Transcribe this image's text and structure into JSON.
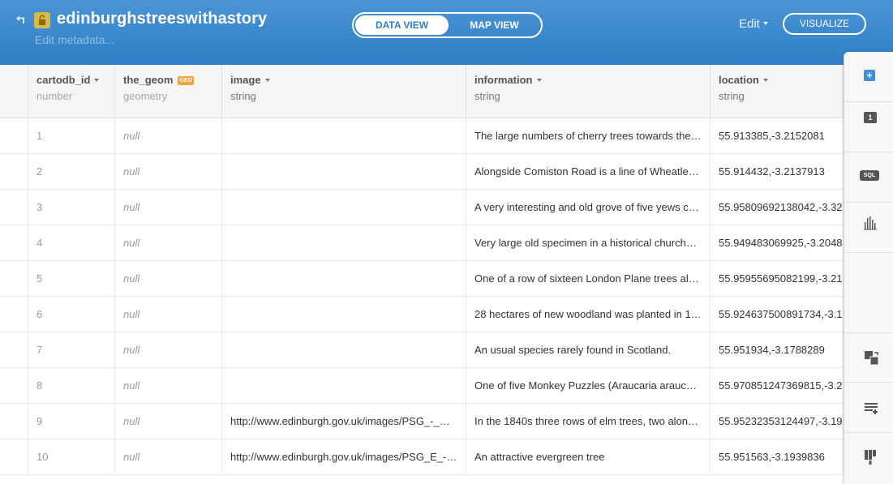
{
  "header": {
    "title": "edinburghstreeswithastory",
    "subtitle": "Edit metadata...",
    "view_toggle": {
      "data_view": "DATA VIEW",
      "map_view": "MAP VIEW",
      "active": "data_view"
    },
    "edit_label": "Edit",
    "visualize_label": "VISUALIZE",
    "colors": {
      "header_bg": "#3a88cc",
      "lock": "#d9b84a",
      "accent": "#2f7fc6"
    }
  },
  "table": {
    "columns": [
      {
        "name": "cartodb_id",
        "type": "number"
      },
      {
        "name": "the_geom",
        "badge": "GEO",
        "type": "geometry"
      },
      {
        "name": "image",
        "type": "string"
      },
      {
        "name": "information",
        "type": "string"
      },
      {
        "name": "location",
        "type": "string"
      }
    ],
    "rows": [
      {
        "id": "1",
        "geom": "null",
        "image": "",
        "information": "The large numbers of cherry trees towards the…",
        "location": "55.913385,-3.2152081"
      },
      {
        "id": "2",
        "geom": "null",
        "image": "",
        "information": "Alongside Comiston Road is a line of Wheatle…",
        "location": "55.914432,-3.2137913"
      },
      {
        "id": "3",
        "geom": "null",
        "image": "",
        "information": "A very interesting and old grove of five yews c…",
        "location": "55.95809692138042,-3.32"
      },
      {
        "id": "4",
        "geom": "null",
        "image": "",
        "information": "Very large old specimen in a historical church…",
        "location": "55.949483069925,-3.2048"
      },
      {
        "id": "5",
        "geom": "null",
        "image": "",
        "information": "One of a row of sixteen London Plane trees al…",
        "location": "55.95955695082199,-3.21"
      },
      {
        "id": "6",
        "geom": "null",
        "image": "",
        "information": "28 hectares of new woodland was planted in 1…",
        "location": "55.924637500891734,-3.1"
      },
      {
        "id": "7",
        "geom": "null",
        "image": "",
        "information": "An usual species rarely found in Scotland.",
        "location": "55.951934,-3.1788289"
      },
      {
        "id": "8",
        "geom": "null",
        "image": "",
        "information": "One of five Monkey Puzzles (Araucaria arauc…",
        "location": "55.970851247369815,-3.2"
      },
      {
        "id": "9",
        "geom": "null",
        "image": "http://www.edinburgh.gov.uk/images/PSG_-_…",
        "information": "In the 1840s three rows of elm trees, two alon…",
        "location": "55.95232353124497,-3.19"
      },
      {
        "id": "10",
        "geom": "null",
        "image": "http://www.edinburgh.gov.uk/images/PSG_E_-…",
        "information": "An attractive evergreen tree",
        "location": "55.951563,-3.1939836"
      }
    ]
  },
  "tools_panel": {
    "items": [
      {
        "name": "add-row-icon",
        "glyph": "+"
      },
      {
        "name": "number-icon",
        "glyph": "1"
      },
      {
        "name": "sql-icon",
        "glyph": "SQL"
      },
      {
        "name": "histogram-icon"
      },
      {
        "name": "merge-tables-icon"
      },
      {
        "name": "add-column-icon"
      },
      {
        "name": "filter-icon"
      }
    ]
  }
}
